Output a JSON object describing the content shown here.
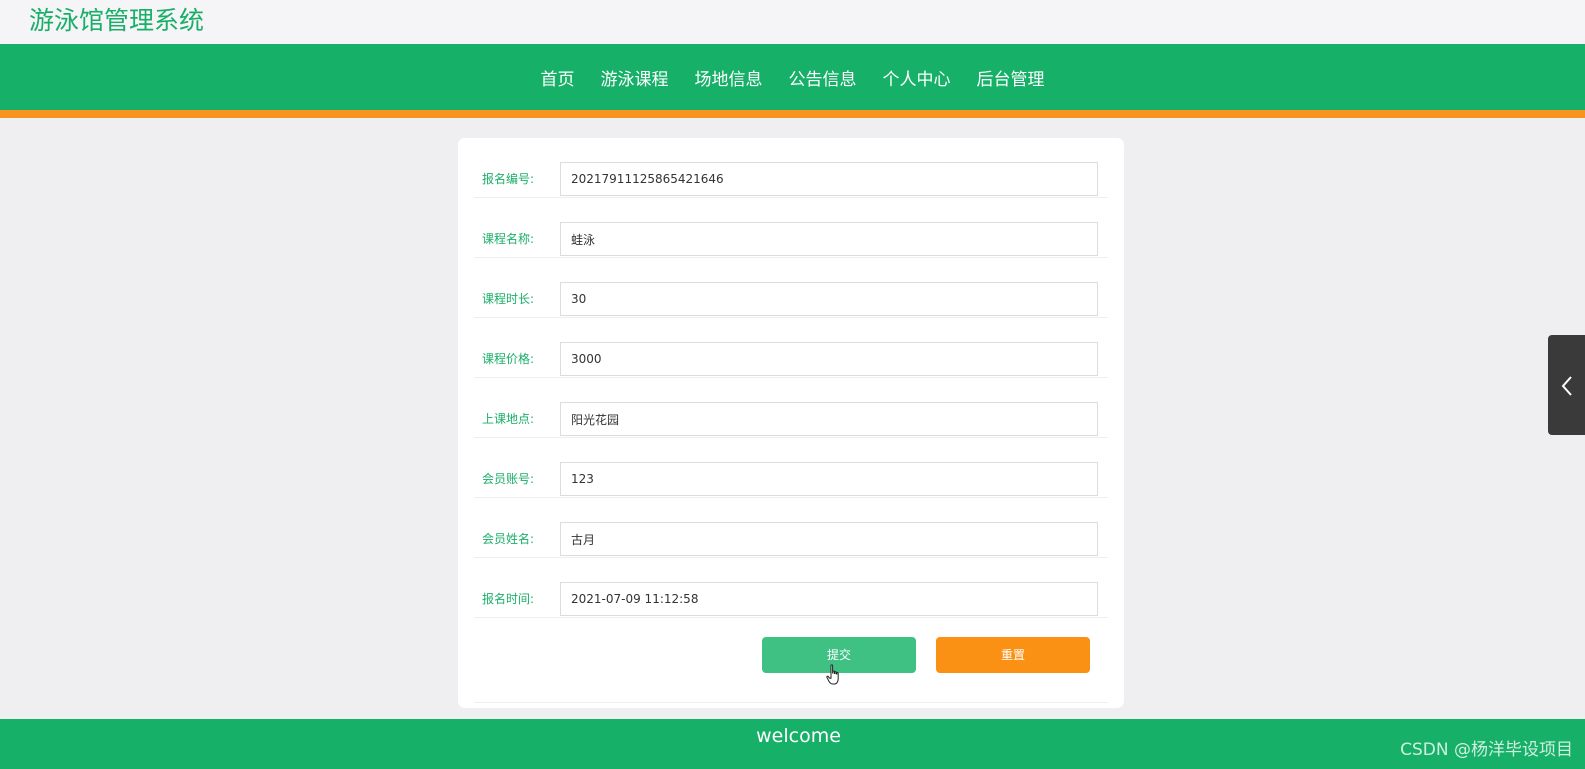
{
  "header": {
    "site_title": "游泳馆管理系统"
  },
  "nav": {
    "items": [
      {
        "label": "首页"
      },
      {
        "label": "游泳课程"
      },
      {
        "label": "场地信息"
      },
      {
        "label": "公告信息"
      },
      {
        "label": "个人中心"
      },
      {
        "label": "后台管理"
      }
    ]
  },
  "form": {
    "fields": [
      {
        "label": "报名编号:",
        "value": "20217911125865421646"
      },
      {
        "label": "课程名称:",
        "value": "蛙泳"
      },
      {
        "label": "课程时长:",
        "value": "30"
      },
      {
        "label": "课程价格:",
        "value": "3000"
      },
      {
        "label": "上课地点:",
        "value": "阳光花园"
      },
      {
        "label": "会员账号:",
        "value": "123"
      },
      {
        "label": "会员姓名:",
        "value": "古月"
      },
      {
        "label": "报名时间:",
        "value": "2021-07-09 11:12:58"
      }
    ],
    "submit_label": "提交",
    "reset_label": "重置"
  },
  "footer": {
    "text": "welcome"
  },
  "watermark": "CSDN @杨洋毕设项目",
  "colors": {
    "brand_green": "#17b068",
    "accent_orange": "#f7941d",
    "submit_green": "#3fc184",
    "reset_orange": "#fa9115"
  },
  "icons": {
    "side_toggle": "chevron-left-icon",
    "cursor": "hand-pointer-icon"
  }
}
